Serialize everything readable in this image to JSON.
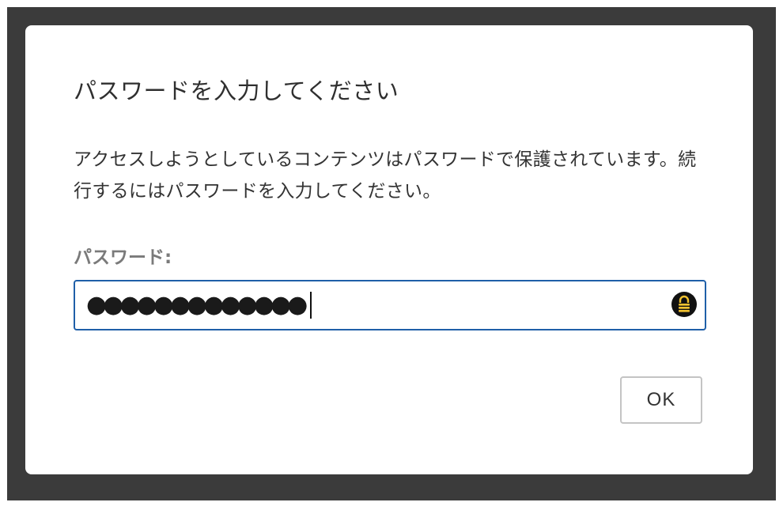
{
  "dialog": {
    "title": "パスワードを入力してください",
    "description": "アクセスしようとしているコンテンツはパスワードで保護されています。続行するにはパスワードを入力してください。",
    "password_label": "パスワード:",
    "password_value": "●●●●●●●●●●●●●",
    "ok_label": "OK"
  },
  "icons": {
    "password_manager_icon": "lock-icon"
  },
  "colors": {
    "overlay": "#3b3b3b",
    "focus_border": "#1f5fa8",
    "icon_bg": "#111111",
    "icon_fg": "#f2c230"
  }
}
